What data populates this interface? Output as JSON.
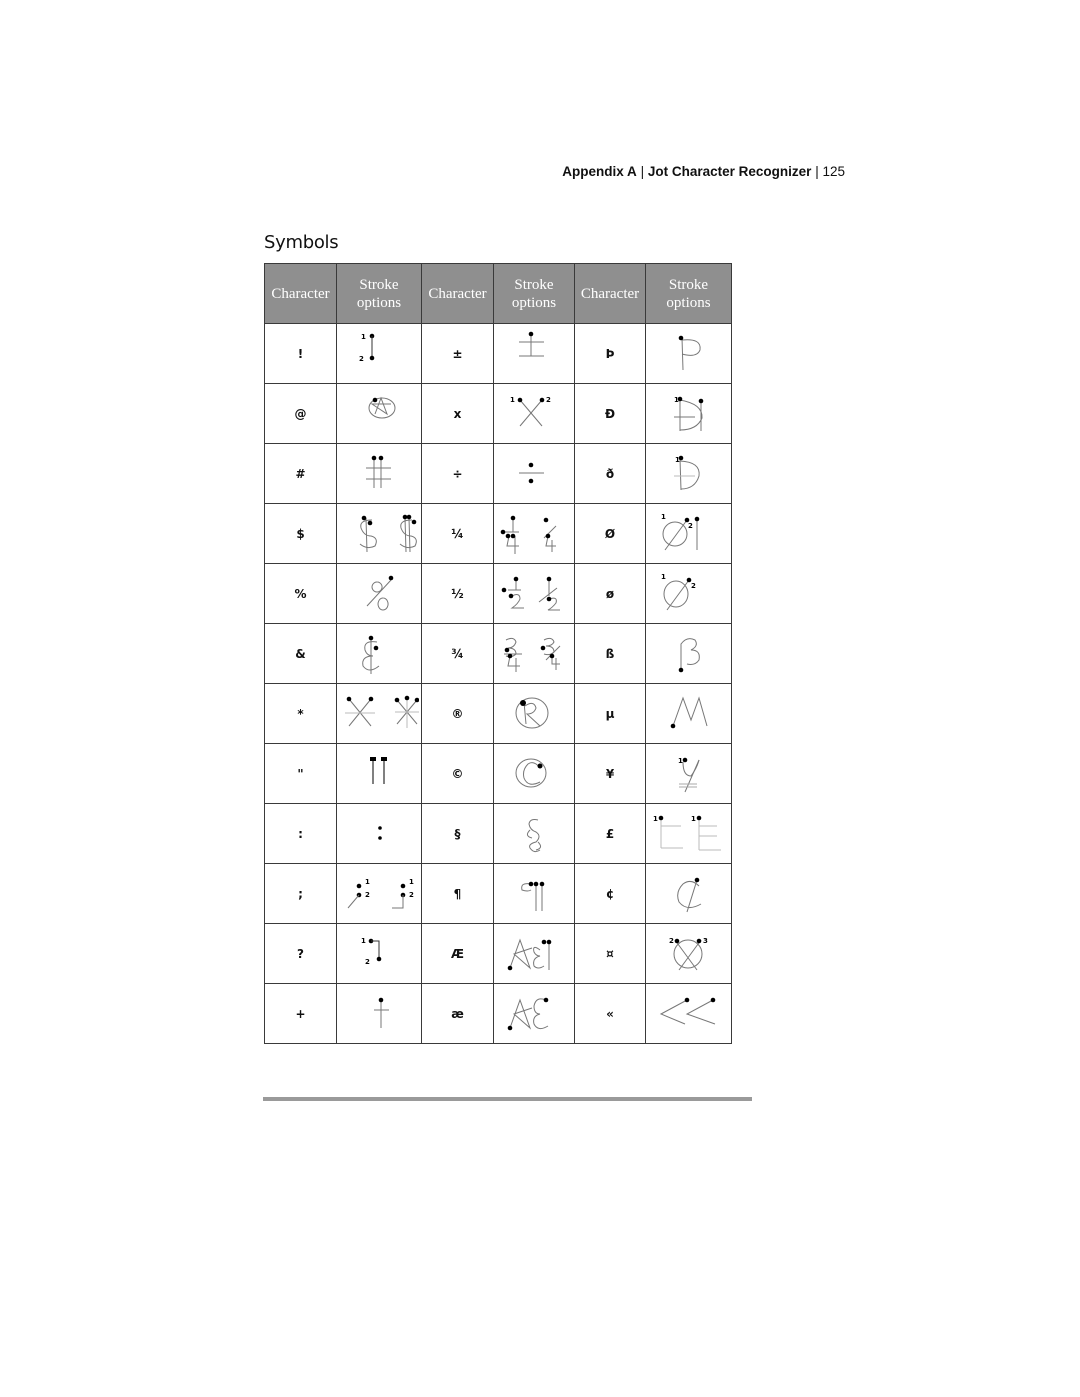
{
  "header": {
    "appendix": "Appendix A",
    "separator": "|",
    "chapter": "Jot Character Recognizer",
    "page_number": "125"
  },
  "section_title": "Symbols",
  "table": {
    "columns": [
      {
        "line1": "Character",
        "line2": ""
      },
      {
        "line1": "Stroke",
        "line2": "options"
      },
      {
        "line1": "Character",
        "line2": ""
      },
      {
        "line1": "Stroke",
        "line2": "options"
      },
      {
        "line1": "Character",
        "line2": ""
      },
      {
        "line1": "Stroke",
        "line2": "options"
      }
    ],
    "rows": [
      [
        {
          "char": "!",
          "stroke": "exclaim"
        },
        {
          "char": "±",
          "stroke": "plusminus"
        },
        {
          "char": "Þ",
          "stroke": "thorn"
        }
      ],
      [
        {
          "char": "@",
          "stroke": "at"
        },
        {
          "char": "x",
          "stroke": "times"
        },
        {
          "char": "Đ",
          "stroke": "eth-cap"
        }
      ],
      [
        {
          "char": "#",
          "stroke": "hash"
        },
        {
          "char": "÷",
          "stroke": "divide"
        },
        {
          "char": "ð",
          "stroke": "eth"
        }
      ],
      [
        {
          "char": "$",
          "stroke": "dollar"
        },
        {
          "char": "¼",
          "stroke": "quarter"
        },
        {
          "char": "Ø",
          "stroke": "oslash-cap"
        }
      ],
      [
        {
          "char": "%",
          "stroke": "percent"
        },
        {
          "char": "½",
          "stroke": "half"
        },
        {
          "char": "ø",
          "stroke": "oslash"
        }
      ],
      [
        {
          "char": "&",
          "stroke": "ampersand"
        },
        {
          "char": "¾",
          "stroke": "threequarter"
        },
        {
          "char": "ß",
          "stroke": "eszett"
        }
      ],
      [
        {
          "char": "*",
          "stroke": "asterisk"
        },
        {
          "char": "®",
          "stroke": "registered"
        },
        {
          "char": "µ",
          "stroke": "micro"
        }
      ],
      [
        {
          "char": "\"",
          "stroke": "quote"
        },
        {
          "char": "©",
          "stroke": "copyright"
        },
        {
          "char": "¥",
          "stroke": "yen"
        }
      ],
      [
        {
          "char": ":",
          "stroke": "colon"
        },
        {
          "char": "§",
          "stroke": "section"
        },
        {
          "char": "£",
          "stroke": "pound"
        }
      ],
      [
        {
          "char": ";",
          "stroke": "semicolon"
        },
        {
          "char": "¶",
          "stroke": "pilcrow"
        },
        {
          "char": "¢",
          "stroke": "cent"
        }
      ],
      [
        {
          "char": "?",
          "stroke": "question"
        },
        {
          "char": "Æ",
          "stroke": "ae-cap"
        },
        {
          "char": "¤",
          "stroke": "currency"
        }
      ],
      [
        {
          "char": "+",
          "stroke": "plus"
        },
        {
          "char": "æ",
          "stroke": "ae"
        },
        {
          "char": "«",
          "stroke": "guillemet"
        }
      ]
    ]
  },
  "stroke_labels": {
    "one": "1",
    "two": "2",
    "three": "3"
  }
}
